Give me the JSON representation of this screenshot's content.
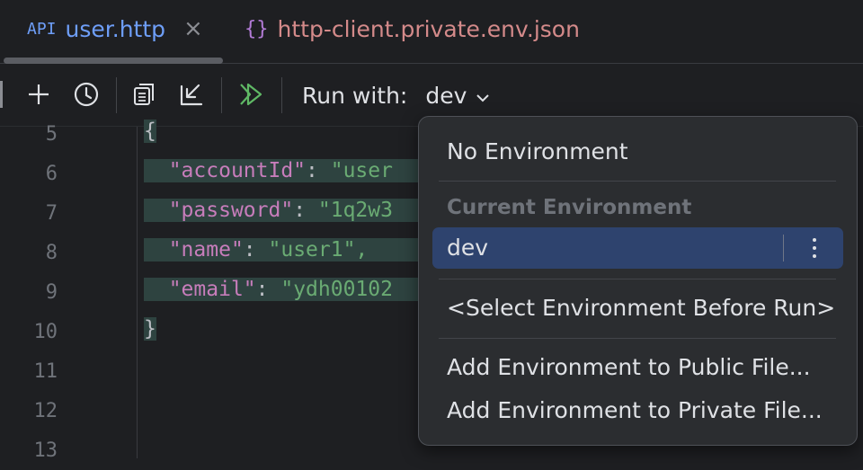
{
  "tabs": [
    {
      "badge": "API",
      "name": "user.http",
      "close": "×"
    },
    {
      "badge": "{}",
      "name": "http-client.private.env.json"
    }
  ],
  "toolbar": {
    "run_with_label": "Run with:",
    "run_with_value": "dev",
    "icons": [
      "add-icon",
      "history-icon",
      "copy-icon",
      "import-icon",
      "run-all-icon"
    ]
  },
  "editor": {
    "lines": [
      {
        "number": "5"
      },
      {
        "number": "6",
        "key": "\"accountId\"",
        "value": "\"user"
      },
      {
        "number": "7",
        "key": "\"password\"",
        "value": "\"1q2w3"
      },
      {
        "number": "8",
        "key": "\"name\"",
        "value": "\"user1\","
      },
      {
        "number": "9",
        "key": "\"email\"",
        "value": "\"ydh00102"
      },
      {
        "number": "10",
        "text": "}"
      },
      {
        "number": "11"
      },
      {
        "number": "12"
      },
      {
        "number": "13"
      }
    ],
    "open_brace": "{"
  },
  "env_menu": {
    "no_env": "No Environment",
    "current_header": "Current Environment",
    "selected": "dev",
    "select_before_run": "<Select Environment Before Run>",
    "add_public": "Add Environment to Public File...",
    "add_private": "Add Environment to Private File..."
  },
  "colors": {
    "selection_bg": "#2e436e",
    "key": "#c77dbb",
    "string": "#6aab73",
    "tab_active": "#6e9ef8",
    "tab_inactive": "#d48a8a",
    "run_icon": "#5fb865"
  }
}
